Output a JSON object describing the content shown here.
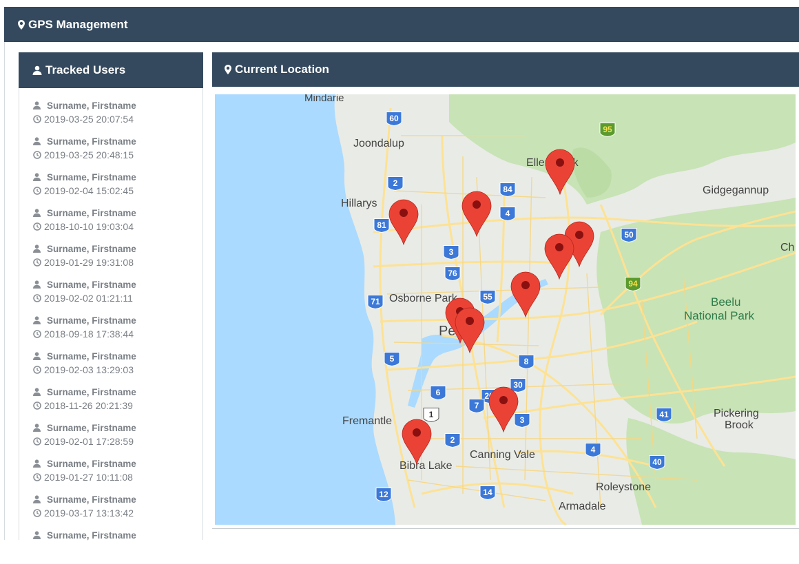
{
  "header": {
    "title": "GPS Management"
  },
  "users_panel": {
    "title": "Tracked Users",
    "users": [
      {
        "name": "Surname, Firstname",
        "time": "2019-03-25 20:07:54"
      },
      {
        "name": "Surname, Firstname",
        "time": "2019-03-25 20:48:15"
      },
      {
        "name": "Surname, Firstname",
        "time": "2019-02-04 15:02:45"
      },
      {
        "name": "Surname, Firstname",
        "time": "2018-10-10 19:03:04"
      },
      {
        "name": "Surname, Firstname",
        "time": "2019-01-29 19:31:08"
      },
      {
        "name": "Surname, Firstname",
        "time": "2019-02-02 01:21:11"
      },
      {
        "name": "Surname, Firstname",
        "time": "2018-09-18 17:38:44"
      },
      {
        "name": "Surname, Firstname",
        "time": "2019-02-03 13:29:03"
      },
      {
        "name": "Surname, Firstname",
        "time": "2018-11-26 20:21:39"
      },
      {
        "name": "Surname, Firstname",
        "time": "2019-02-01 17:28:59"
      },
      {
        "name": "Surname, Firstname",
        "time": "2019-01-27 10:11:08"
      },
      {
        "name": "Surname, Firstname",
        "time": "2019-03-17 13:13:42"
      },
      {
        "name": "Surname, Firstname",
        "time": ""
      }
    ]
  },
  "location_panel": {
    "title": "Current Location"
  },
  "map": {
    "places": {
      "mindarie": "Mindarie",
      "joondalup": "Joondalup",
      "ellenbrook": "Ellenbrook",
      "gidgegannup": "Gidgegannup",
      "hillarys": "Hillarys",
      "osborne_park": "Osborne Park",
      "perth": "Perth",
      "beelu": "Beelu",
      "national_park": "National Park",
      "fremantle": "Fremantle",
      "canning_vale": "Canning Vale",
      "bibra_lake": "Bibra Lake",
      "pickering": "Pickering",
      "brook": "Brook",
      "roleystone": "Roleystone",
      "armadale": "Armadale",
      "ch": "Ch"
    },
    "routes": [
      "60",
      "95",
      "2",
      "84",
      "4",
      "81",
      "50",
      "3",
      "76",
      "94",
      "71",
      "55",
      "5",
      "8",
      "26",
      "30",
      "6",
      "7",
      "1",
      "3",
      "41",
      "2",
      "4",
      "40",
      "12",
      "14"
    ],
    "colors": {
      "water": "#aadaff",
      "land": "#e8eae4",
      "park": "#c7e3b4",
      "road": "#fde293",
      "marker": "#ea4335"
    }
  }
}
